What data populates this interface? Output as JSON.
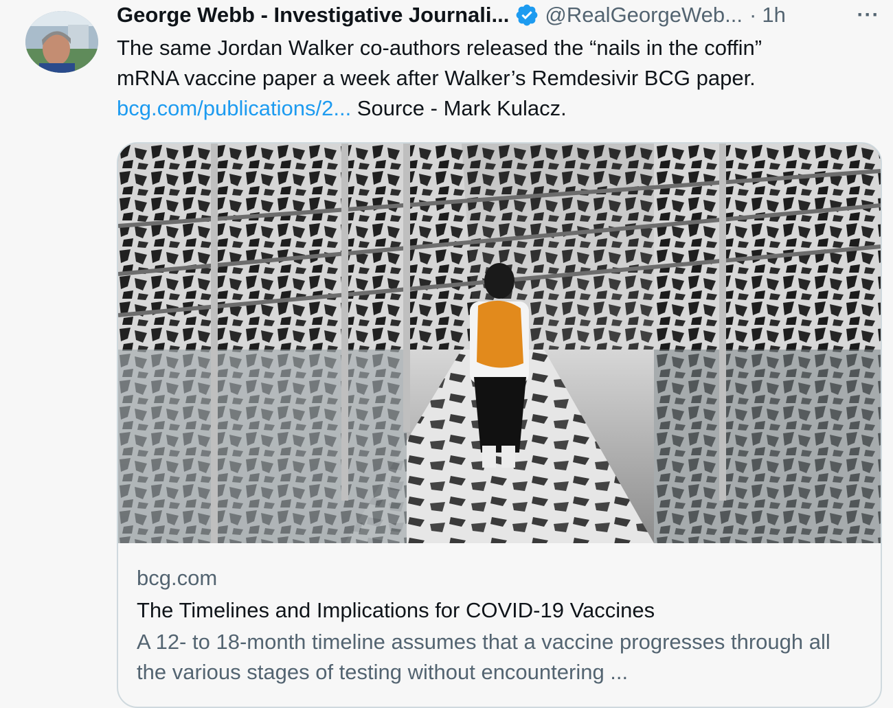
{
  "tweet": {
    "author_name": "George Webb - Investigative Journali...",
    "handle": "@RealGeorgeWeb...",
    "separator": "·",
    "time": "1h",
    "more_label": "···",
    "text_line1": "The same Jordan Walker co-authors released the “nails in the coffin”",
    "text_line2": "mRNA vaccine paper a week after Walker’s Remdesivir BCG paper.",
    "link_text": "bcg.com/publications/2...",
    "text_after_link": " Source - Mark Kulacz.",
    "verified_icon": "verified-badge-icon",
    "accent_color": "#1d9bf0"
  },
  "card": {
    "domain": "bcg.com",
    "title": "The Timelines and Implications for COVID-19 Vaccines",
    "description": "A 12- to 18-month timeline assumes that a vaccine progresses through all the various stages of testing without encountering ..."
  }
}
